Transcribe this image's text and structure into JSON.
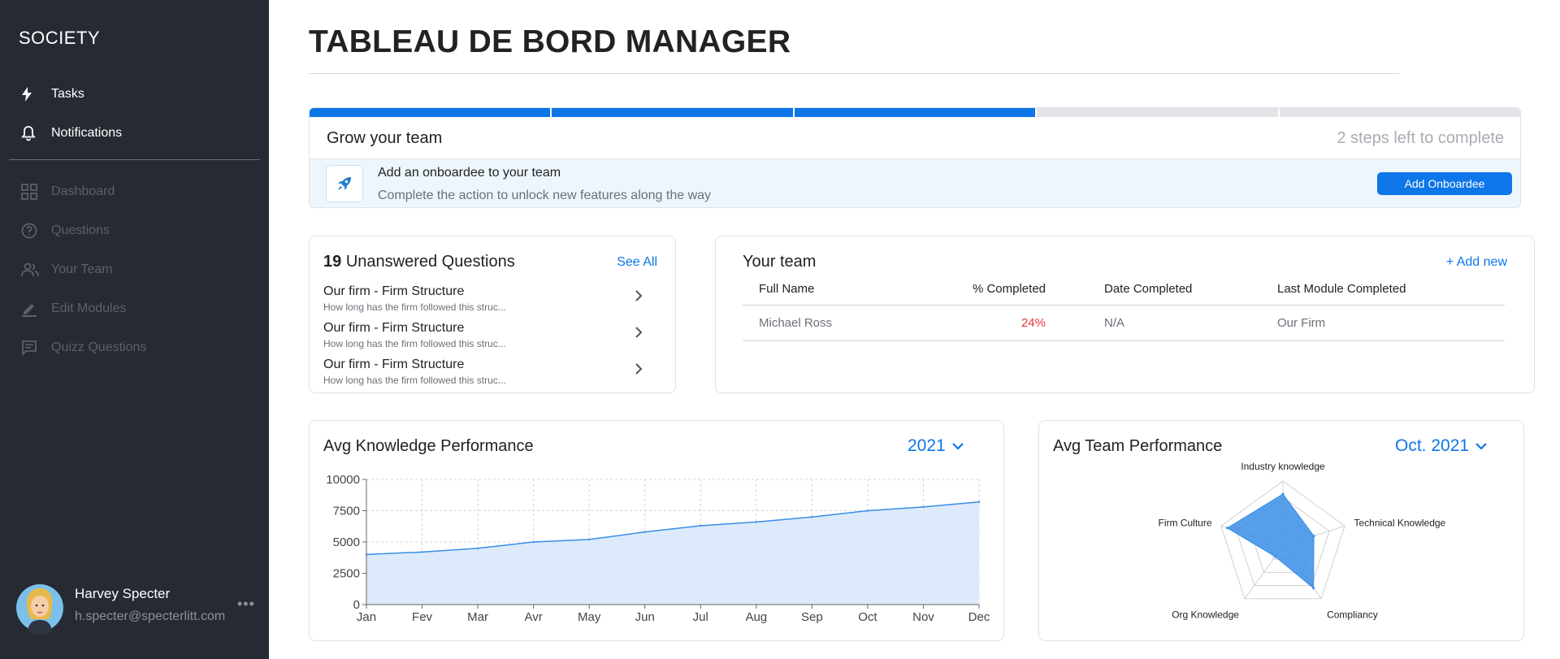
{
  "sidebar": {
    "brand": "SOCIETY",
    "primary": [
      {
        "label": "Tasks",
        "icon": "lightning-icon"
      },
      {
        "label": "Notifications",
        "icon": "bell-icon"
      }
    ],
    "secondary": [
      {
        "label": "Dashboard",
        "icon": "grid-icon"
      },
      {
        "label": "Questions",
        "icon": "question-circle-icon"
      },
      {
        "label": "Your Team",
        "icon": "people-icon"
      },
      {
        "label": "Edit Modules",
        "icon": "pencil-icon"
      },
      {
        "label": "Quizz Questions",
        "icon": "message-list-icon"
      }
    ],
    "user": {
      "name": "Harvey Specter",
      "email": "h.specter@specterlitt.com",
      "more": "•••"
    }
  },
  "page": {
    "title": "TABLEAU DE BORD MANAGER"
  },
  "onboarding": {
    "steps_total": 5,
    "steps_done": 3,
    "title": "Grow your team",
    "steps_left": "2 steps left to complete",
    "action_title": "Add an onboardee to your team",
    "action_subtitle": "Complete the action to unlock new features along the way",
    "button": "Add Onboardee",
    "accent": "#0d76e8"
  },
  "questions": {
    "count": "19",
    "title": "Unanswered Questions",
    "see_all": "See All",
    "items": [
      {
        "title": "Our firm - Firm Structure",
        "sub": "How long has the firm followed this struc..."
      },
      {
        "title": "Our firm - Firm Structure",
        "sub": "How long has the firm followed this struc..."
      },
      {
        "title": "Our firm - Firm Structure",
        "sub": "How long has the firm followed this struc..."
      }
    ]
  },
  "team": {
    "title": "Your team",
    "add_new": "+ Add new",
    "columns": [
      "Full Name",
      "% Completed",
      "Date Completed",
      "Last Module Completed"
    ],
    "rows": [
      {
        "name": "Michael Ross",
        "completed": "24%",
        "date": "N/A",
        "module": "Our Firm"
      }
    ]
  },
  "knowledge": {
    "title": "Avg Knowledge Performance",
    "period": "2021"
  },
  "team_perf": {
    "title": "Avg Team Performance",
    "period": "Oct. 2021"
  },
  "chart_data": [
    {
      "type": "area",
      "title": "Avg Knowledge Performance",
      "categories": [
        "Jan",
        "Fev",
        "Mar",
        "Avr",
        "May",
        "Jun",
        "Jul",
        "Aug",
        "Sep",
        "Oct",
        "Nov",
        "Dec"
      ],
      "values": [
        4000,
        4200,
        4500,
        5000,
        5200,
        5800,
        6300,
        6600,
        7000,
        7500,
        7800,
        8200
      ],
      "ylim": [
        0,
        10000
      ],
      "yticks": [
        0,
        2500,
        5000,
        7500,
        10000
      ],
      "grid": true,
      "color": "#3a8ee6",
      "fill": "#dceafb"
    },
    {
      "type": "radar",
      "title": "Avg Team Performance",
      "categories": [
        "Industry knowledge",
        "Technical Knowledge",
        "Compliancy",
        "Org Knowledge",
        "Firm Culture"
      ],
      "values": [
        0.8,
        0.5,
        0.8,
        0.2,
        0.9
      ],
      "range": [
        0,
        1
      ],
      "levels": 4,
      "color": "#3a8ee6"
    }
  ]
}
